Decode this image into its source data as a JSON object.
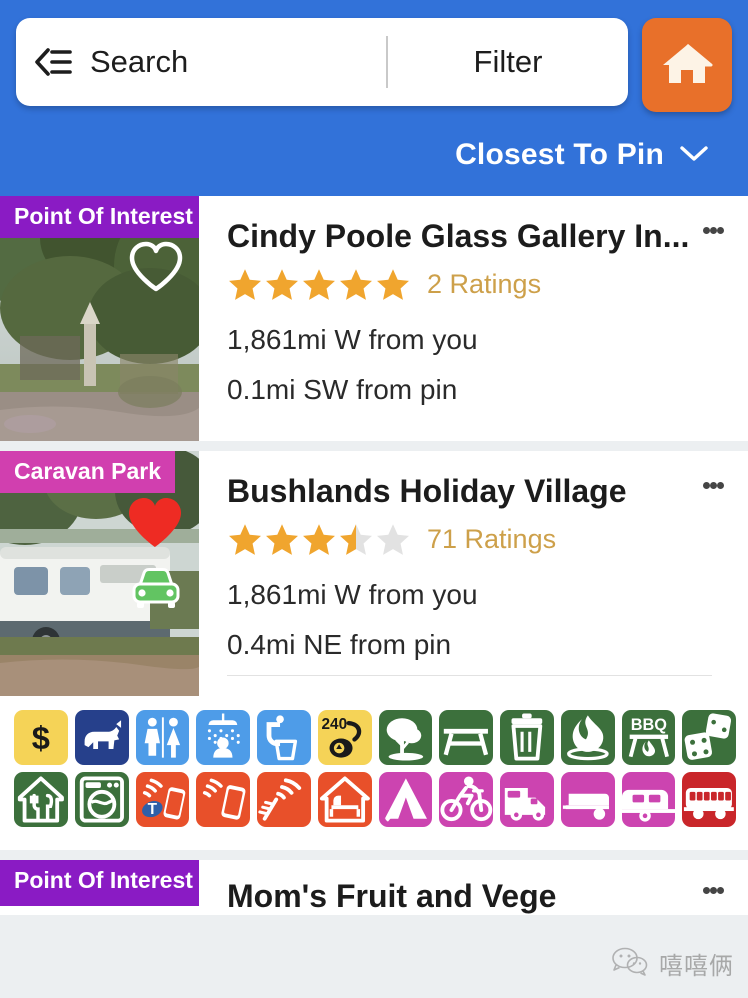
{
  "header": {
    "search_placeholder": "Search",
    "filter_label": "Filter",
    "menu_icon": "back-menu-icon",
    "home_icon": "home-icon",
    "home_button_color": "#e8702a",
    "background_color": "#3272d9",
    "sort_label": "Closest To Pin",
    "sort_chevron_icon": "chevron-down-icon"
  },
  "listings": [
    {
      "category": "Point Of Interest",
      "category_color": "#8a1bc4",
      "title": "Cindy Poole Glass Gallery In...",
      "rating": 5,
      "rating_count_label": "2 Ratings",
      "distance_from_you": "1,861mi W from you",
      "distance_from_pin": "0.1mi SW from pin",
      "favorite": false,
      "favorite_icon": "heart-outline-icon",
      "has_car_badge": false,
      "menu_icon": "kebab-menu-icon",
      "amenities": []
    },
    {
      "category": "Caravan Park",
      "category_color": "#d13faf",
      "title": "Bushlands Holiday Village",
      "rating": 3.5,
      "rating_count_label": "71 Ratings",
      "distance_from_you": "1,861mi W from you",
      "distance_from_pin": "0.4mi NE from pin",
      "favorite": true,
      "favorite_icon": "heart-filled-icon",
      "has_car_badge": true,
      "car_badge_icon": "green-car-icon",
      "menu_icon": "kebab-menu-icon",
      "amenities": [
        {
          "name": "fees-icon",
          "label": "$",
          "bg": "#f5d357",
          "fg": "#1a1a1a"
        },
        {
          "name": "dogs-allowed-icon",
          "label": "",
          "bg": "#26408b",
          "fg": "#ffffff"
        },
        {
          "name": "toilets-icon",
          "label": "",
          "bg": "#4e9ce8",
          "fg": "#ffffff"
        },
        {
          "name": "showers-icon",
          "label": "",
          "bg": "#4e9ce8",
          "fg": "#ffffff"
        },
        {
          "name": "drinking-water-icon",
          "label": "",
          "bg": "#4e9ce8",
          "fg": "#ffffff"
        },
        {
          "name": "power-240v-icon",
          "label": "240",
          "bg": "#f5d357",
          "fg": "#1a1a1a"
        },
        {
          "name": "shade-trees-icon",
          "label": "",
          "bg": "#3c703c",
          "fg": "#ffffff"
        },
        {
          "name": "picnic-table-icon",
          "label": "",
          "bg": "#3c703c",
          "fg": "#ffffff"
        },
        {
          "name": "rubbish-bin-icon",
          "label": "",
          "bg": "#3c703c",
          "fg": "#ffffff"
        },
        {
          "name": "campfire-icon",
          "label": "",
          "bg": "#3c703c",
          "fg": "#ffffff"
        },
        {
          "name": "bbq-icon",
          "label": "BBQ",
          "bg": "#3c703c",
          "fg": "#ffffff"
        },
        {
          "name": "games-dice-icon",
          "label": "",
          "bg": "#3c703c",
          "fg": "#ffffff"
        },
        {
          "name": "restaurant-icon",
          "label": "",
          "bg": "#3c703c",
          "fg": "#ffffff"
        },
        {
          "name": "laundry-icon",
          "label": "",
          "bg": "#3c703c",
          "fg": "#ffffff"
        },
        {
          "name": "telstra-signal-icon",
          "label": "",
          "bg": "#e8502a",
          "fg": "#ffffff"
        },
        {
          "name": "mobile-signal-icon",
          "label": "",
          "bg": "#e8502a",
          "fg": "#ffffff"
        },
        {
          "name": "tv-antenna-icon",
          "label": "",
          "bg": "#e8502a",
          "fg": "#ffffff"
        },
        {
          "name": "cabin-icon",
          "label": "",
          "bg": "#e8502a",
          "fg": "#ffffff"
        },
        {
          "name": "tent-site-icon",
          "label": "",
          "bg": "#cc44b0",
          "fg": "#ffffff"
        },
        {
          "name": "motorcycle-icon",
          "label": "",
          "bg": "#cc44b0",
          "fg": "#ffffff"
        },
        {
          "name": "motorhome-icon",
          "label": "",
          "bg": "#cc44b0",
          "fg": "#ffffff"
        },
        {
          "name": "camper-trailer-icon",
          "label": "",
          "bg": "#cc44b0",
          "fg": "#ffffff"
        },
        {
          "name": "caravan-icon",
          "label": "",
          "bg": "#cc44b0",
          "fg": "#ffffff"
        },
        {
          "name": "bus-icon",
          "label": "",
          "bg": "#c9262a",
          "fg": "#ffffff"
        }
      ]
    },
    {
      "category": "Point Of Interest",
      "category_color": "#8a1bc4",
      "title": "Mom's Fruit and Vege",
      "menu_icon": "kebab-menu-icon"
    }
  ],
  "watermark": {
    "text": "嘻嘻俩",
    "icon": "wechat-logo-icon"
  },
  "theme": {
    "star_filled": "#f0a52e",
    "star_empty": "#e2e2e2",
    "rating_text": "#cda04a",
    "page_bg": "#eceff1"
  }
}
